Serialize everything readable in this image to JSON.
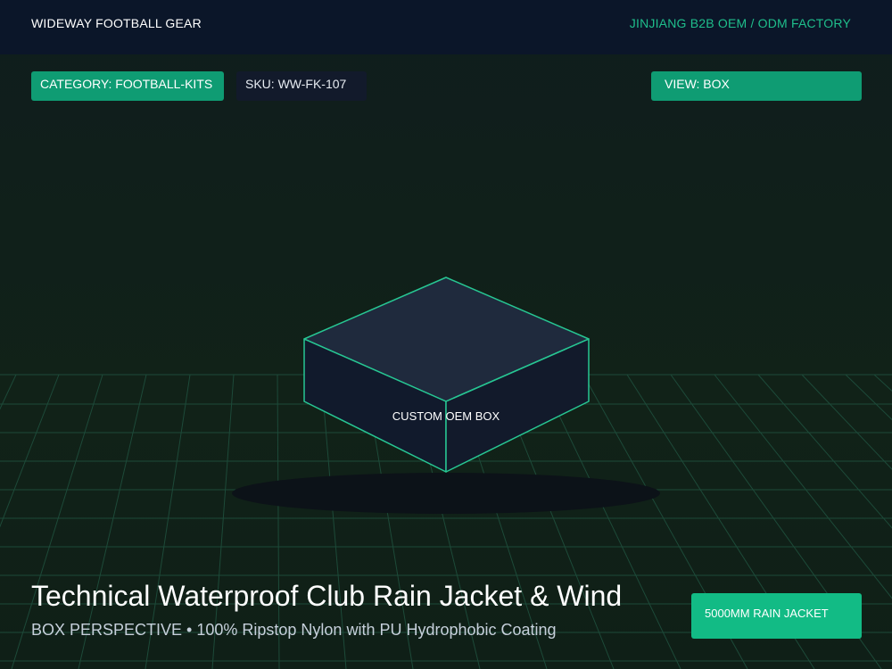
{
  "header": {
    "brand": "WIDEWAY FOOTBALL GEAR",
    "factory": "JINJIANG B2B OEM / ODM FACTORY"
  },
  "tags": {
    "category": "CATEGORY: FOOTBALL-KITS",
    "sku": "SKU: WW-FK-107",
    "view": "VIEW: BOX"
  },
  "box": {
    "label": "CUSTOM OEM BOX"
  },
  "product": {
    "title": "Technical Waterproof Club Rain Jacket & Wind",
    "subtitle": "BOX PERSPECTIVE • 100% Ripstop Nylon with PU Hydrophobic Coating",
    "badge": "5000MM RAIN JACKET"
  },
  "colors": {
    "accent": "#0f9c73",
    "box_edge": "#27c693",
    "header_bg": "#0b1629"
  }
}
